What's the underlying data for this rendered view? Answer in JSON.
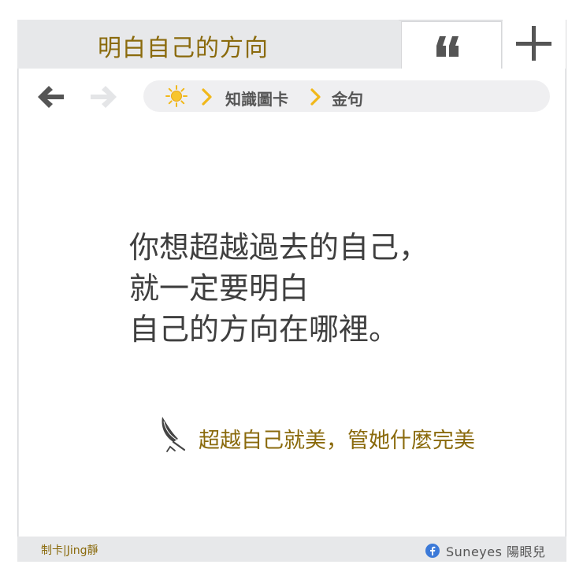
{
  "tabs": {
    "active_title": "明白自己的方向",
    "quote_tab_icon": "quote-icon",
    "new_tab_icon": "plus-icon"
  },
  "nav": {
    "back_icon": "arrow-left-icon",
    "forward_icon": "arrow-right-icon"
  },
  "breadcrumb": {
    "home_icon": "sun-icon",
    "items": [
      "知識圖卡",
      "金句"
    ]
  },
  "quote": {
    "lines": [
      "你想超越過去的自己，",
      "就一定要明白",
      "自己的方向在哪裡。"
    ]
  },
  "signature": {
    "icon": "quill-icon",
    "text": "超越自己就美，管她什麼完美"
  },
  "footer": {
    "maker": "制卡|Jing靜",
    "brand_icon": "facebook-icon",
    "brand": "Suneyes 陽眼兒"
  },
  "colors": {
    "accent_gold": "#8a6a0c",
    "chevron_yellow": "#f1b81a",
    "chrome_gray": "#e7e8ea",
    "text_dark": "#3f3f3f",
    "facebook_blue": "#3b79d8"
  }
}
